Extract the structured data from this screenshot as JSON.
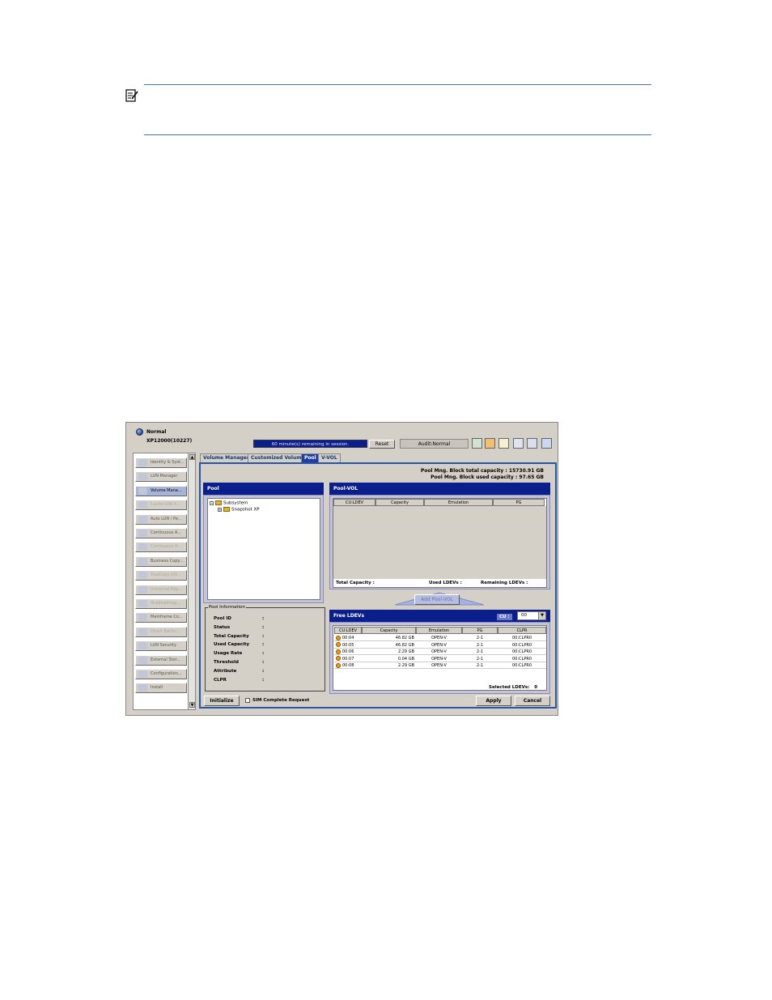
{
  "app": {
    "status": "Normal",
    "model": "XP12000(10227)",
    "session_text": "60 minute(s) remaining in session.",
    "reset_label": "Reset",
    "audit_text": "Audit:Normal"
  },
  "sidebar": {
    "items": [
      {
        "label": "Identity & Syst...",
        "state": "normal"
      },
      {
        "label": "LUN Manager",
        "state": "normal"
      },
      {
        "label": "Volume Mana...",
        "state": "selected"
      },
      {
        "label": "Cache LUN X...",
        "state": "dim"
      },
      {
        "label": "Auto LUN / Pe...",
        "state": "normal"
      },
      {
        "label": "Continuous A...",
        "state": "normal"
      },
      {
        "label": "Continuous A...",
        "state": "dim"
      },
      {
        "label": "Business Copy...",
        "state": "normal"
      },
      {
        "label": "TrueCopy z/O...",
        "state": "dim"
      },
      {
        "label": "Universal Rep...",
        "state": "dim"
      },
      {
        "label": "Shadowimag...",
        "state": "dim"
      },
      {
        "label": "Mainframe Co...",
        "state": "normal"
      },
      {
        "label": "Direct Backu...",
        "state": "dim"
      },
      {
        "label": "LUN Security",
        "state": "normal"
      },
      {
        "label": "External Stor...",
        "state": "normal"
      },
      {
        "label": "Configuration...",
        "state": "normal"
      },
      {
        "label": "Install",
        "state": "normal"
      }
    ]
  },
  "tabs": [
    {
      "label": "Volume Manager",
      "active": false
    },
    {
      "label": "Customized Volume",
      "active": false
    },
    {
      "label": "Pool",
      "active": true
    },
    {
      "label": "V-VOL",
      "active": false
    }
  ],
  "capacity": {
    "total_label": "Pool Mng. Block total capacity :",
    "total_value": "15730.91 GB",
    "used_label": "Pool Mng. Block used capacity :",
    "used_value": "97.65 GB"
  },
  "pool_panel": {
    "title": "Pool",
    "tree_root": "Subsystem",
    "tree_child": "Snapshot XP"
  },
  "pool_info": {
    "title": "Pool Information",
    "labels": [
      "Pool ID",
      "Status",
      "Total Capacity",
      "Used Capacity",
      "Usage Rate",
      "Threshold",
      "Attribute",
      "CLPR"
    ],
    "colon": ":"
  },
  "pool_vol": {
    "title": "Pool-VOL",
    "columns": [
      "CU:LDEV",
      "Capacity",
      "Emulation",
      "PG"
    ],
    "footer_total": "Total Capacity :",
    "footer_used": "Used LDEVs :",
    "footer_remaining": "Remaining LDEVs :"
  },
  "add_button": "Add Pool-VOL",
  "free_ldevs": {
    "title": "Free LDEVs",
    "cu_label": "CU :",
    "cu_value": "00",
    "columns": [
      "CU:LDEV",
      "Capacity",
      "Emulation",
      "PG",
      "CLPR"
    ],
    "rows": [
      {
        "ldev": "00:04",
        "capacity": "46.82 GB",
        "emulation": "OPEN-V",
        "pg": "2-1",
        "clpr": "00:CLPR0"
      },
      {
        "ldev": "00:05",
        "capacity": "46.82 GB",
        "emulation": "OPEN-V",
        "pg": "2-1",
        "clpr": "00:CLPR0"
      },
      {
        "ldev": "00:06",
        "capacity": "2.29 GB",
        "emulation": "OPEN-V",
        "pg": "2-1",
        "clpr": "00:CLPR0"
      },
      {
        "ldev": "00:07",
        "capacity": "0.04 GB",
        "emulation": "OPEN-V",
        "pg": "2-1",
        "clpr": "00:CLPR0"
      },
      {
        "ldev": "00:08",
        "capacity": "2.29 GB",
        "emulation": "OPEN-V",
        "pg": "2-1",
        "clpr": "00:CLPR0"
      }
    ],
    "selected_label": "Selected LDEVs:",
    "selected_value": "0"
  },
  "bottom": {
    "initialize": "Initialize",
    "sim_label": "SIM Complete Request",
    "apply": "Apply",
    "cancel": "Cancel"
  }
}
